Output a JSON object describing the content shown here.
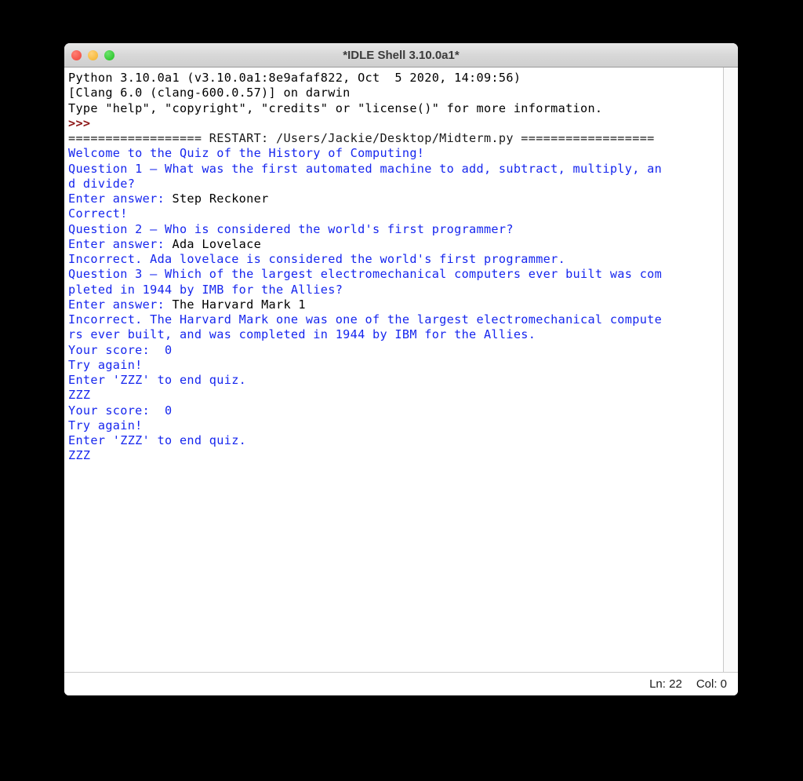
{
  "window": {
    "title": "*IDLE Shell 3.10.0a1*",
    "traffic_lights": [
      {
        "name": "close-button",
        "color": "#f4554a"
      },
      {
        "name": "minimize-button",
        "color": "#f6bb3f"
      },
      {
        "name": "maximize-button",
        "color": "#35ca35"
      }
    ]
  },
  "colors": {
    "stdout_blue": "#1626ee",
    "stdin_black": "#000000",
    "prompt_red": "#8d1616",
    "background": "#ffffff",
    "titlebar": "#d8d8d8"
  },
  "shell": {
    "lines": [
      {
        "segments": [
          {
            "text": "Python 3.10.0a1 (v3.10.0a1:8e9afaf822, Oct  5 2020, 14:09:56)",
            "style": "black"
          }
        ]
      },
      {
        "segments": [
          {
            "text": "[Clang 6.0 (clang-600.0.57)] on darwin",
            "style": "black"
          }
        ]
      },
      {
        "segments": [
          {
            "text": "Type \"help\", \"copyright\", \"credits\" or \"license()\" for more information.",
            "style": "black"
          }
        ]
      },
      {
        "segments": [
          {
            "text": ">>>",
            "style": "prompt"
          }
        ]
      },
      {
        "segments": [
          {
            "text": "================== RESTART: /Users/Jackie/Desktop/Midterm.py ==================",
            "style": "restart"
          }
        ]
      },
      {
        "segments": [
          {
            "text": "Welcome to the Quiz of the History of Computing!",
            "style": "blue"
          }
        ]
      },
      {
        "segments": [
          {
            "text": "Question 1 — What was the first automated machine to add, subtract, multiply, an",
            "style": "blue"
          }
        ]
      },
      {
        "segments": [
          {
            "text": "d divide?",
            "style": "blue"
          }
        ]
      },
      {
        "segments": [
          {
            "text": "Enter answer: ",
            "style": "blue"
          },
          {
            "text": "Step Reckoner",
            "style": "black"
          }
        ]
      },
      {
        "segments": [
          {
            "text": "Correct!",
            "style": "blue"
          }
        ]
      },
      {
        "segments": [
          {
            "text": "Question 2 — Who is considered the world's first programmer?",
            "style": "blue"
          }
        ]
      },
      {
        "segments": [
          {
            "text": "Enter answer: ",
            "style": "blue"
          },
          {
            "text": "Ada Lovelace",
            "style": "black"
          }
        ]
      },
      {
        "segments": [
          {
            "text": "Incorrect. Ada lovelace is considered the world's first programmer.",
            "style": "blue"
          }
        ]
      },
      {
        "segments": [
          {
            "text": "Question 3 — Which of the largest electromechanical computers ever built was com",
            "style": "blue"
          }
        ]
      },
      {
        "segments": [
          {
            "text": "pleted in 1944 by IMB for the Allies?",
            "style": "blue"
          }
        ]
      },
      {
        "segments": [
          {
            "text": "Enter answer: ",
            "style": "blue"
          },
          {
            "text": "The Harvard Mark 1",
            "style": "black"
          }
        ]
      },
      {
        "segments": [
          {
            "text": "Incorrect. The Harvard Mark one was one of the largest electromechanical compute",
            "style": "blue"
          }
        ]
      },
      {
        "segments": [
          {
            "text": "rs ever built, and was completed in 1944 by IBM for the Allies.",
            "style": "blue"
          }
        ]
      },
      {
        "segments": [
          {
            "text": "Your score:  0",
            "style": "blue"
          }
        ]
      },
      {
        "segments": [
          {
            "text": "Try again!",
            "style": "blue"
          }
        ]
      },
      {
        "segments": [
          {
            "text": "Enter 'ZZZ' to end quiz.",
            "style": "blue"
          }
        ]
      },
      {
        "segments": [
          {
            "text": "ZZZ",
            "style": "blue"
          }
        ]
      },
      {
        "segments": [
          {
            "text": "Your score:  0",
            "style": "blue"
          }
        ]
      },
      {
        "segments": [
          {
            "text": "Try again!",
            "style": "blue"
          }
        ]
      },
      {
        "segments": [
          {
            "text": "Enter 'ZZZ' to end quiz.",
            "style": "blue"
          }
        ]
      },
      {
        "segments": [
          {
            "text": "ZZZ",
            "style": "blue"
          }
        ]
      }
    ]
  },
  "statusbar": {
    "line_label": "Ln: 22",
    "col_label": "Col: 0"
  }
}
